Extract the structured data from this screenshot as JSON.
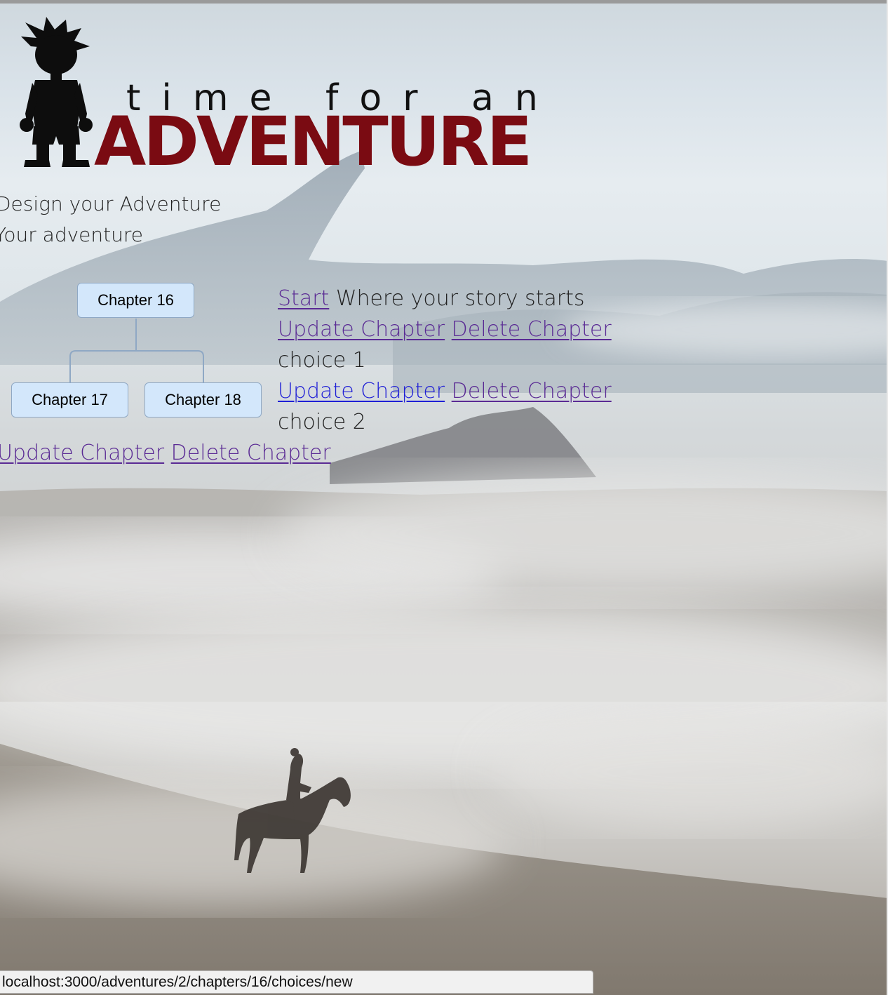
{
  "logo": {
    "line1": "time for an",
    "line2": "ADVENTURE",
    "brand_color": "#7a0b12"
  },
  "headings": {
    "design": "Design your Adventure",
    "yours": "Your adventure"
  },
  "tree": {
    "root": "Chapter 16",
    "children": [
      "Chapter 17",
      "Chapter 18"
    ]
  },
  "content": {
    "start_link": "Start",
    "start_desc": "Where your story starts",
    "update_label": "Update Chapter",
    "delete_label": "Delete Chapter",
    "choice1": "choice 1",
    "choice2": "choice 2"
  },
  "status_url": "localhost:3000/adventures/2/chapters/16/choices/new",
  "colors": {
    "link_visited": "#5a2a94",
    "link_active": "#1f1fd6",
    "node_fill": "#d3e7fb",
    "node_border": "#8fa8c4"
  }
}
